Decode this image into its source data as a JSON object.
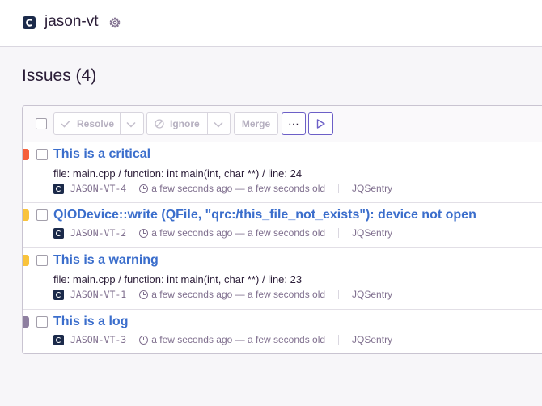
{
  "project": {
    "name": "jason-vt",
    "logo_icon": "c-logo-icon",
    "settings_icon": "gear-icon"
  },
  "issues": {
    "heading": "Issues (4)"
  },
  "toolbar": {
    "resolve_label": "Resolve",
    "ignore_label": "Ignore",
    "merge_label": "Merge",
    "more_label": "⋯",
    "play_icon": "play-icon"
  },
  "colors": {
    "critical": "#f55f3b",
    "warning": "#f9c33c",
    "log": "#8e7fa0",
    "link": "#3b6ecc",
    "accent": "#6c5fc7"
  },
  "rows": [
    {
      "level": "critical",
      "title": "This is a critical",
      "culprit": "file: main.cpp / function: int main(int, char **) / line: 24",
      "short_id": "JASON-VT-4",
      "time": "a few seconds ago — a few seconds old",
      "assignee": "JQSentry"
    },
    {
      "level": "warning",
      "title": "QIODevice::write (QFile, \"qrc:/this_file_not_exists\"): device not open",
      "culprit": "",
      "short_id": "JASON-VT-2",
      "time": "a few seconds ago — a few seconds old",
      "assignee": "JQSentry"
    },
    {
      "level": "warning",
      "title": "This is a warning",
      "culprit": "file: main.cpp / function: int main(int, char **) / line: 23",
      "short_id": "JASON-VT-1",
      "time": "a few seconds ago — a few seconds old",
      "assignee": "JQSentry"
    },
    {
      "level": "log",
      "title": "This is a log",
      "culprit": "",
      "short_id": "JASON-VT-3",
      "time": "a few seconds ago — a few seconds old",
      "assignee": "JQSentry"
    }
  ]
}
